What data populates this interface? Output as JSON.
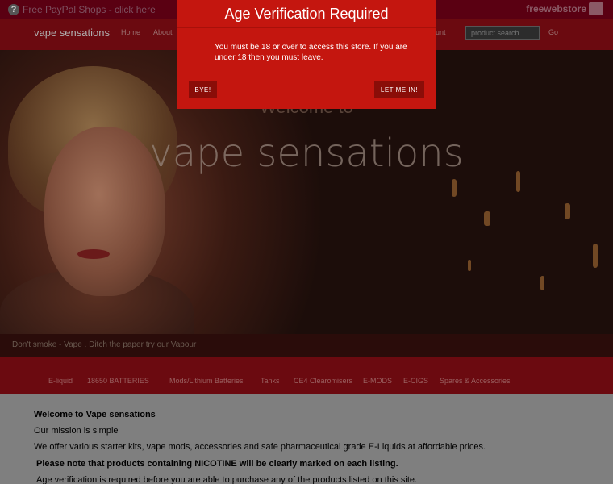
{
  "topbar": {
    "help_glyph": "?",
    "promo_text": "Free PayPal Shops - click here",
    "brand": "freewebstore"
  },
  "nav": {
    "brand": "vape sensations",
    "links": [
      "Home",
      "About",
      "unt"
    ],
    "search_placeholder": "product search",
    "go_label": "Go"
  },
  "hero": {
    "welcome": "Welcome to",
    "title": "vape sensations",
    "caption": "Don't smoke - Vape . Ditch the paper try our Vapour"
  },
  "categories": [
    "E-liquid",
    "18650 BATTERIES",
    "Mods/Lithium Batteries",
    "Tanks",
    "CE4 Clearomisers",
    "E-MODS",
    "E-CIGS",
    "Spares & Accessories"
  ],
  "content": {
    "heading": "Welcome to Vape sensations",
    "line1": "Our mission is simple",
    "line2": "We offer various starter kits, vape mods, accessories and safe pharmaceutical grade E-Liquids at affordable prices.",
    "line3": "Please note that products containing NICOTINE will be clearly marked on each listing.",
    "line4": "Age verification is required before you are able to purchase any of the products listed on this site."
  },
  "modal": {
    "title": "Age Verification Required",
    "message": "You must be 18 or over to access this store. If you are under 18 then you must leave.",
    "bye_label": "BYE!",
    "enter_label": "LET ME IN!"
  },
  "colors": {
    "modal_red": "#c4160f",
    "nav_maroon": "#6b0a10"
  }
}
